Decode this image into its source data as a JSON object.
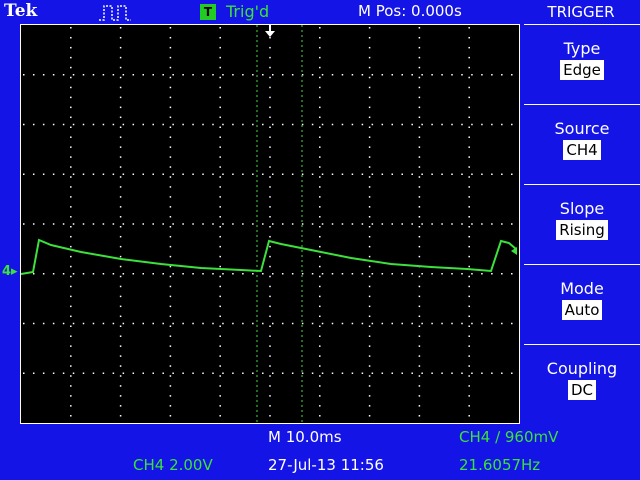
{
  "header": {
    "brand": "Tek",
    "acquisition_icon": "acquire-run-icon",
    "trigger_badge": "T",
    "trigger_status": "Trig'd",
    "main_position": "M Pos: 0.000s"
  },
  "menu": {
    "title": "TRIGGER",
    "items": [
      {
        "label": "Type",
        "value": "Edge"
      },
      {
        "label": "Source",
        "value": "CH4"
      },
      {
        "label": "Slope",
        "value": "Rising"
      },
      {
        "label": "Mode",
        "value": "Auto"
      },
      {
        "label": "Coupling",
        "value": "DC"
      }
    ]
  },
  "channel_marker": "4",
  "footer": {
    "timebase": "M 10.0ms",
    "trigger_level": "CH4 ∕ 960mV",
    "channel_scale": "CH4  2.00V",
    "datetime": "27-Jul-13 11:56",
    "frequency": "21.6057Hz"
  },
  "colors": {
    "background": "#1414e6",
    "trace": "#3ce13c",
    "grid": "#ffffff",
    "screen": "#000000"
  }
}
